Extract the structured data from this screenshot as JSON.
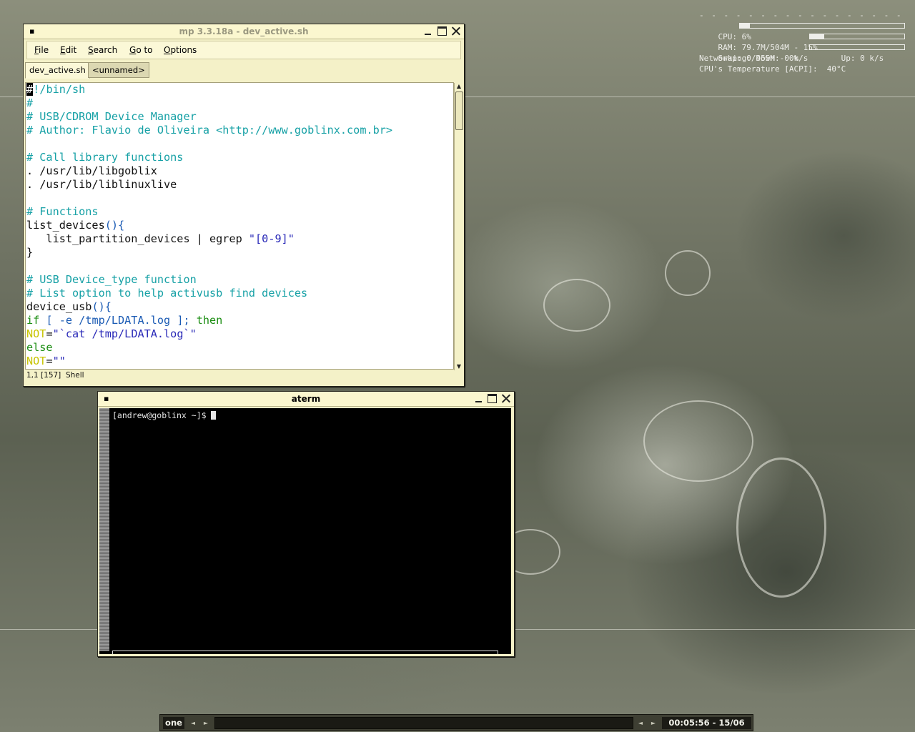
{
  "conky": {
    "separator": "- - - - - - - - - - - - - - - - - - - - - -",
    "cpu_label": "CPU: 6%",
    "cpu_usage": 0.06,
    "ram_label": "RAM: 79.7M/504M - 15%",
    "ram_usage": 0.15,
    "swap_label": "Swap: 0/455M - 0%",
    "swap_usage": 0.0,
    "networking": "Networking: Down: 0 k/s       Up: 0 k/s",
    "temperature": "CPU's Temperature [ACPI]:  40°C"
  },
  "editor": {
    "window_menu": "▪",
    "title": "mp 3.3.18a - dev_active.sh",
    "menu": {
      "file": "File",
      "edit": "Edit",
      "search": "Search",
      "goto": "Go to",
      "options": "Options"
    },
    "tabs": {
      "active": "dev_active.sh",
      "other": "<unnamed>"
    },
    "status": "1,1 [157]  Shell",
    "lines": [
      [
        {
          "t": "#",
          "c": "cursor"
        },
        {
          "t": "!/bin/sh",
          "c": "c-com"
        }
      ],
      [
        {
          "t": "#",
          "c": "c-com"
        }
      ],
      [
        {
          "t": "# USB/CDROM Device Manager",
          "c": "c-com"
        }
      ],
      [
        {
          "t": "# Author: Flavio de Oliveira <http://www.goblinx.com.br>",
          "c": "c-com"
        }
      ],
      [],
      [
        {
          "t": "# Call library functions",
          "c": "c-com"
        }
      ],
      [
        {
          "t": ". /usr/lib/libgoblix",
          "c": "c-def"
        }
      ],
      [
        {
          "t": ". /usr/lib/liblinuxlive",
          "c": "c-def"
        }
      ],
      [],
      [
        {
          "t": "# Functions",
          "c": "c-com"
        }
      ],
      [
        {
          "t": "list_devices",
          "c": "c-def"
        },
        {
          "t": "(){",
          "c": "c-op"
        }
      ],
      [
        {
          "t": "   list_partition_devices | egrep ",
          "c": "c-def"
        },
        {
          "t": "\"[0-9]\"",
          "c": "c-str"
        }
      ],
      [
        {
          "t": "}",
          "c": "c-def"
        }
      ],
      [],
      [
        {
          "t": "# USB Device_type function",
          "c": "c-com"
        }
      ],
      [
        {
          "t": "# List option to help activusb find devices",
          "c": "c-com"
        }
      ],
      [
        {
          "t": "device_usb",
          "c": "c-def"
        },
        {
          "t": "(){",
          "c": "c-op"
        }
      ],
      [
        {
          "t": "if",
          "c": "c-kw"
        },
        {
          "t": " [ -e /tmp/LDATA.log ]; ",
          "c": "c-op"
        },
        {
          "t": "then",
          "c": "c-kw"
        }
      ],
      [
        {
          "t": "NOT",
          "c": "c-var"
        },
        {
          "t": "=",
          "c": "c-def"
        },
        {
          "t": "\"`cat /tmp/LDATA.log`\"",
          "c": "c-str"
        }
      ],
      [
        {
          "t": "else",
          "c": "c-kw"
        }
      ],
      [
        {
          "t": "NOT",
          "c": "c-var"
        },
        {
          "t": "=",
          "c": "c-def"
        },
        {
          "t": "\"\"",
          "c": "c-str"
        }
      ]
    ]
  },
  "terminal": {
    "window_menu": "▪",
    "title": "aterm",
    "prompt": "[andrew@goblinx ~]$ "
  },
  "taskbar": {
    "workspace": "one",
    "clock": "00:05:56 - 15/06"
  }
}
